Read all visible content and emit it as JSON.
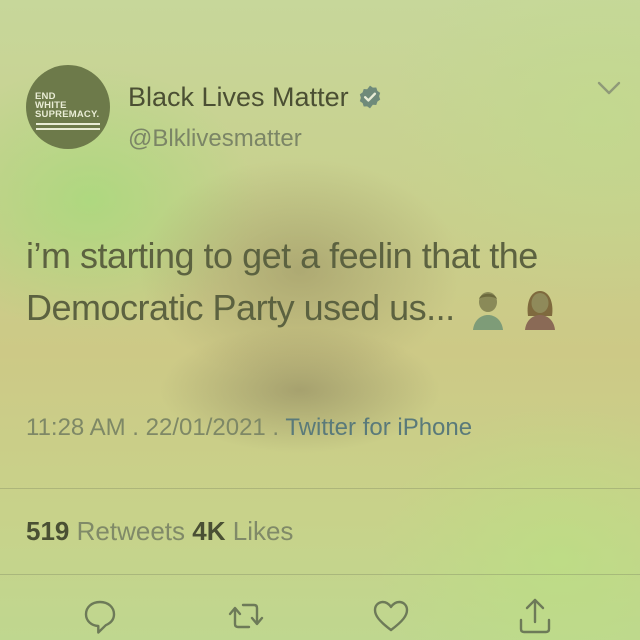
{
  "profile": {
    "avatar_logo_lines": [
      "END",
      "WHITE",
      "SUPREMACY."
    ],
    "display_name": "Black Lives Matter",
    "handle": "@Blklivesmatter",
    "verified": true
  },
  "tweet": {
    "text": "i’m starting to get a feelin that the Democratic Party used us...",
    "emojis": [
      "man-emoji",
      "woman-emoji"
    ]
  },
  "meta": {
    "time": "11:28 AM",
    "separator1": " . ",
    "date": "22/01/2021",
    "separator2": " . ",
    "source": "Twitter for iPhone"
  },
  "stats": {
    "retweets_count": "519",
    "retweets_label": "Retweets",
    "likes_count": "4K",
    "likes_label": "Likes"
  },
  "actions": [
    "reply-icon",
    "retweet-icon",
    "like-icon",
    "share-icon"
  ],
  "colors": {
    "verified_badge": "#6f8a7a",
    "link": "#5a7a7a",
    "tint": "#c9d28c"
  }
}
